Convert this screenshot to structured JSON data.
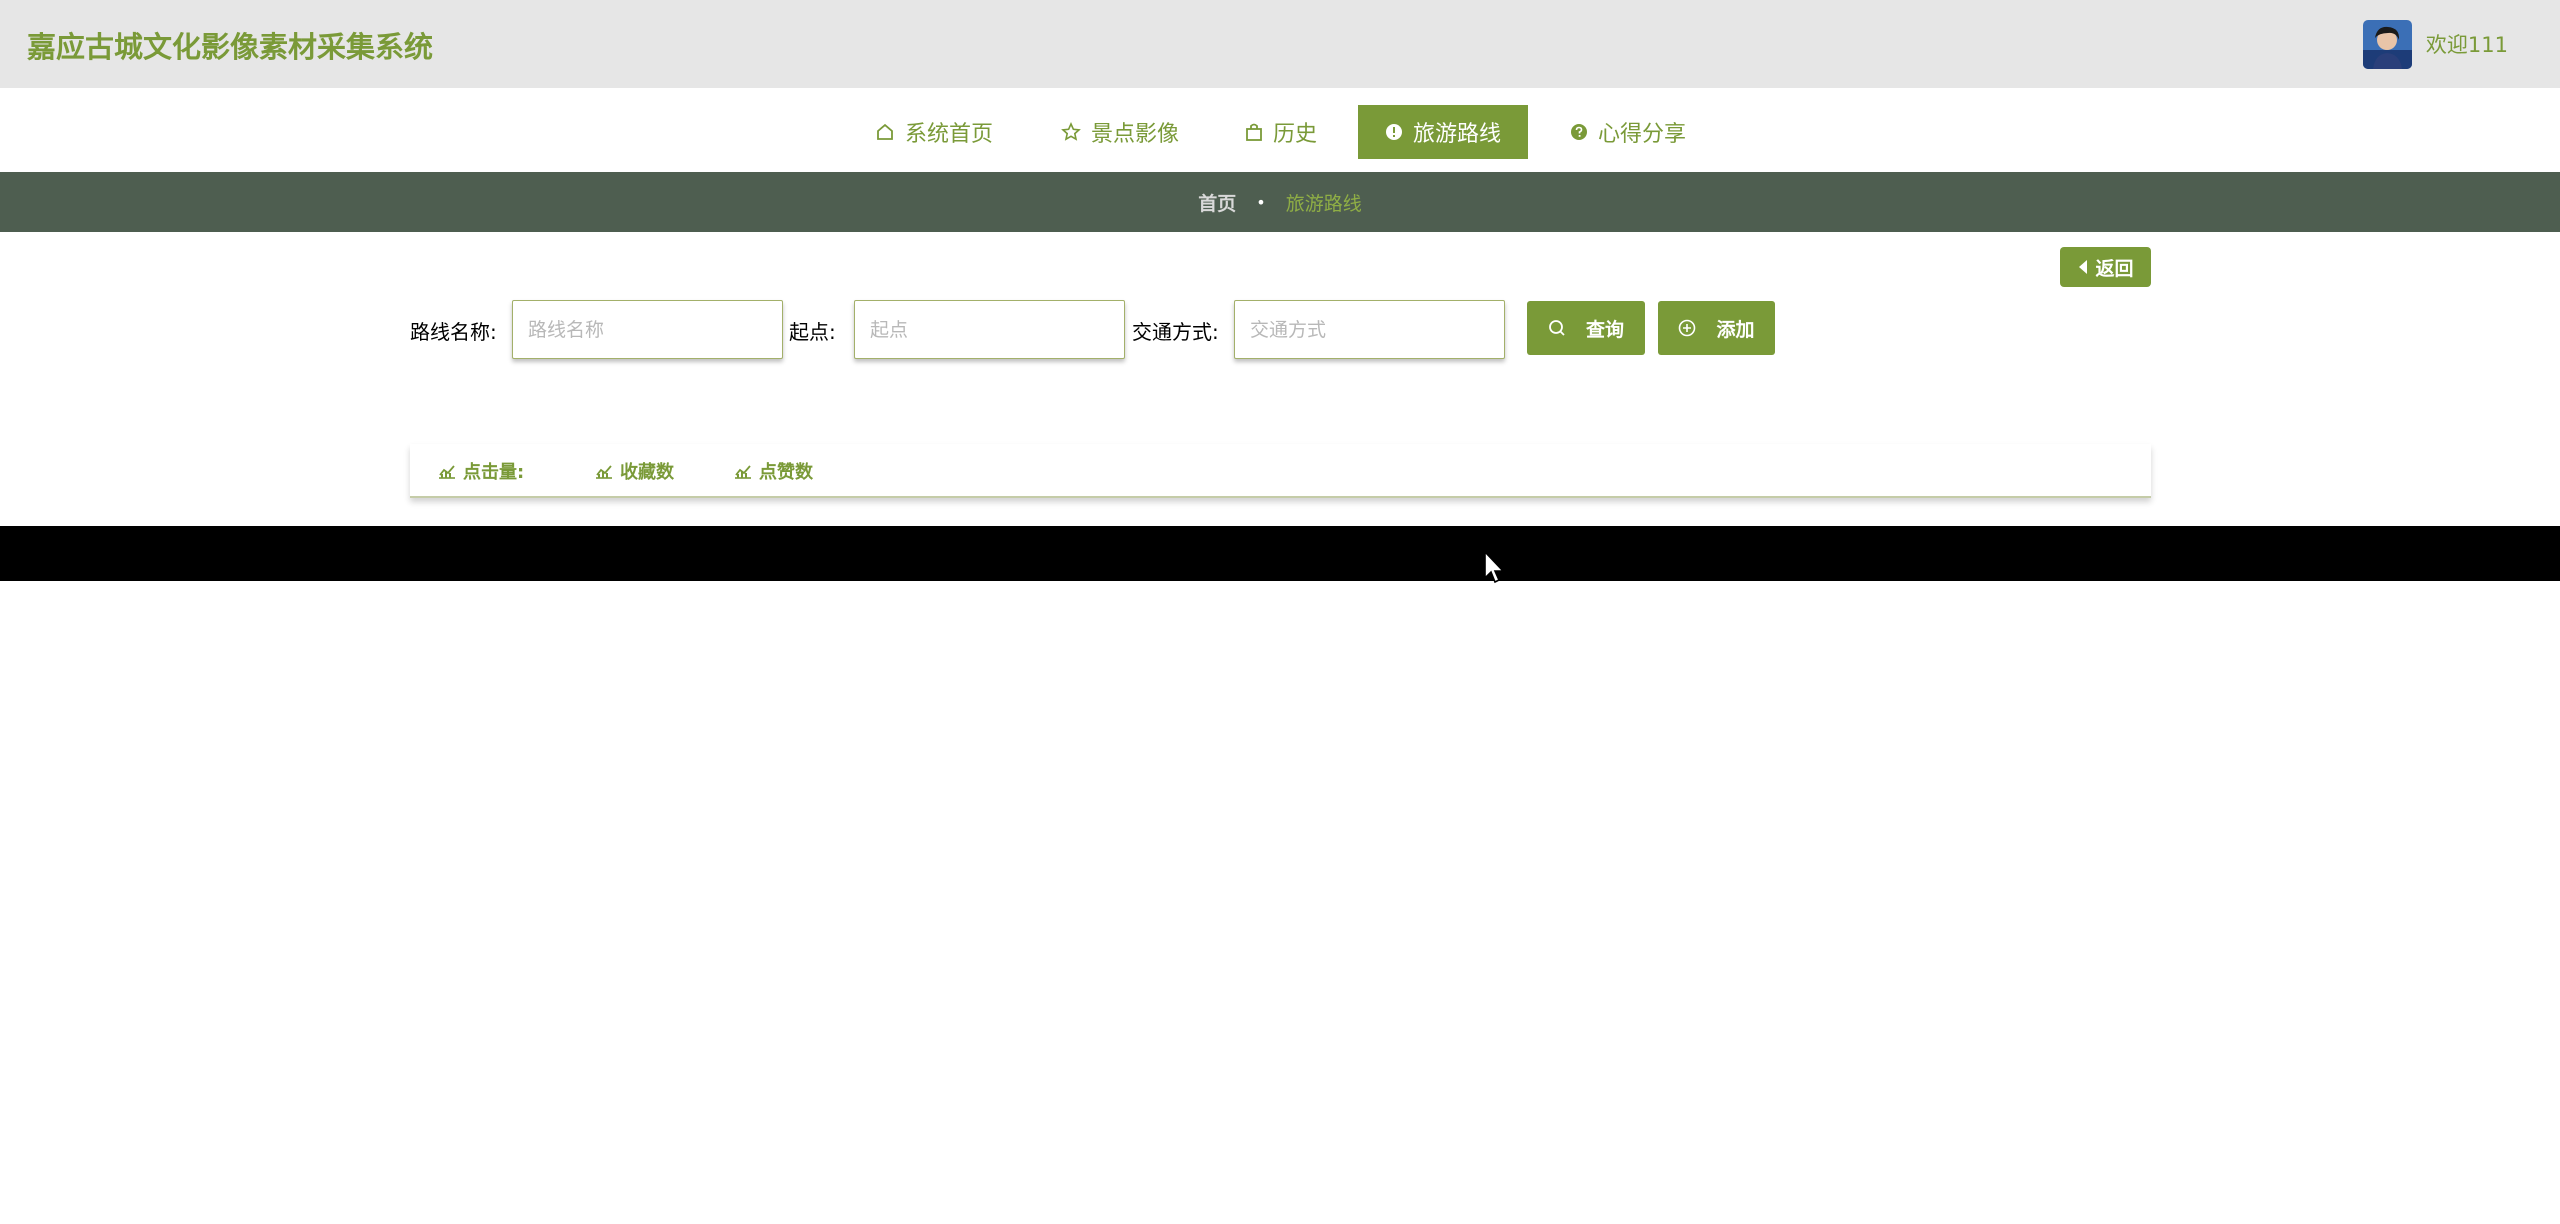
{
  "header": {
    "title": "嘉应古城文化影像素材采集系统",
    "welcome": "欢迎111"
  },
  "nav": {
    "items": [
      {
        "label": "系统首页",
        "icon": "home-icon"
      },
      {
        "label": "景点影像",
        "icon": "star-icon"
      },
      {
        "label": "历史",
        "icon": "bag-icon"
      },
      {
        "label": "旅游路线",
        "icon": "alert-circle-icon",
        "active": true
      },
      {
        "label": "心得分享",
        "icon": "question-circle-icon"
      }
    ]
  },
  "breadcrumb": {
    "home": "首页",
    "separator": "•",
    "current": "旅游路线"
  },
  "back_label": "返回",
  "search": {
    "route_name_label": "路线名称:",
    "route_name_placeholder": "路线名称",
    "start_label": "起点:",
    "start_placeholder": "起点",
    "transport_label": "交通方式:",
    "transport_placeholder": "交通方式",
    "query_label": "查询",
    "add_label": "添加"
  },
  "stats": {
    "clicks_label": "点击量:",
    "favorites_label": "收藏数",
    "likes_label": "点赞数"
  },
  "colors": {
    "accent": "#7a9a38",
    "header_bg": "#e6e6e6",
    "breadcrumb_bg": "#4e5e50",
    "footer_bg": "#000000"
  }
}
